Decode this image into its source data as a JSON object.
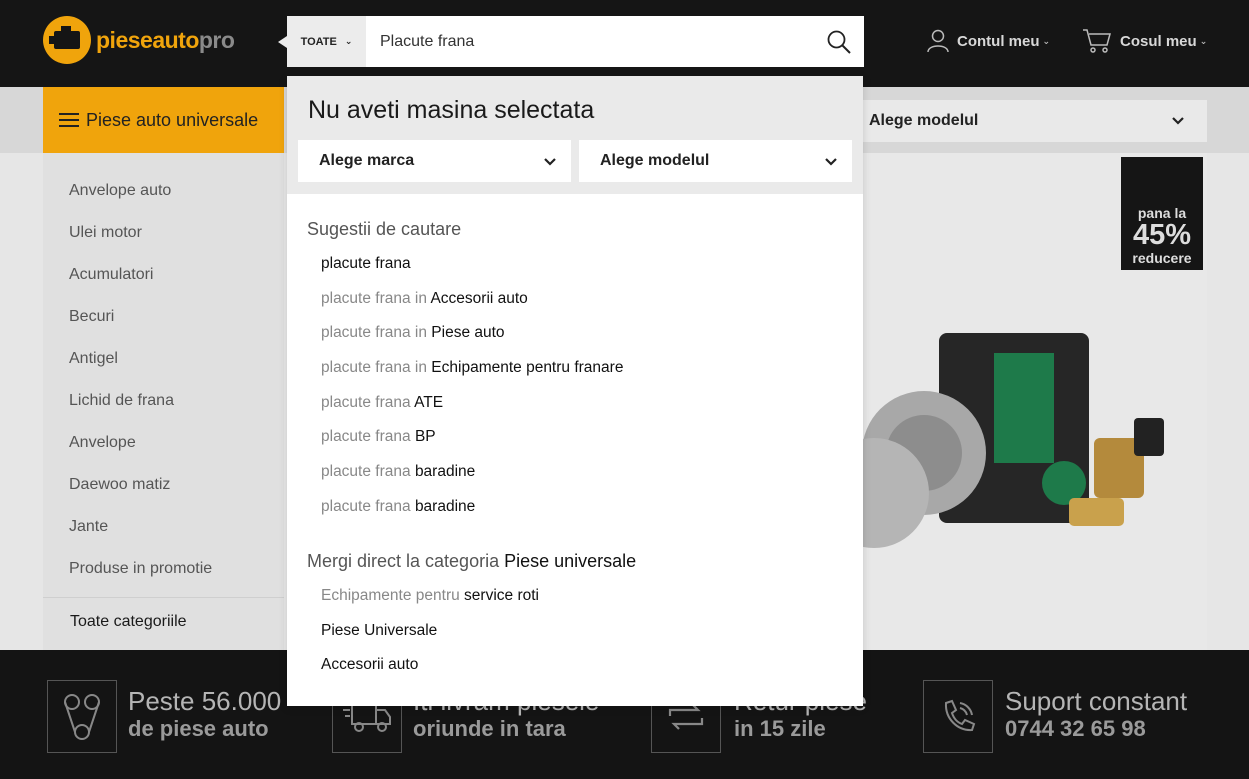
{
  "header": {
    "logo": {
      "part1": "pieseauto",
      "part2": "pro"
    },
    "account_label": "Contul meu",
    "cart_label": "Cosul meu",
    "icons": [
      "engine-logo-icon",
      "user-icon",
      "cart-icon",
      "search-icon"
    ]
  },
  "search": {
    "category": "TOATE",
    "value": "Placute frana"
  },
  "nav": {
    "universal_label": "Piese auto universale",
    "background_model_label": "Alege modelul"
  },
  "sidebar": {
    "items": [
      "Anvelope auto",
      "Ulei motor",
      "Acumulatori",
      "Becuri",
      "Antigel",
      "Lichid de frana",
      "Anvelope",
      "Daewoo matiz",
      "Jante",
      "Produse in promotie"
    ],
    "all_label": "Toate categoriile"
  },
  "promo": {
    "line1": "pana la",
    "line2": "45%",
    "line3": "reducere"
  },
  "features": [
    {
      "title": "Peste 56.000",
      "sub": "de piese auto",
      "icon": "timing-belt-icon"
    },
    {
      "title": "Iti livram piesele",
      "sub": "oriunde in tara",
      "icon": "delivery-truck-icon"
    },
    {
      "title": "Retur piese",
      "sub": "in 15 zile",
      "icon": "return-arrows-icon"
    },
    {
      "title": "Suport constant",
      "sub": "0744 32 65 98",
      "icon": "phone-icon"
    }
  ],
  "dropdown": {
    "heading": "Nu aveti masina selectata",
    "brand_select": "Alege marca",
    "model_select": "Alege modelul",
    "suggestions_title": "Sugestii de cautare",
    "suggestions": [
      {
        "prefix": "",
        "term": "placute frana"
      },
      {
        "prefix": "placute frana in ",
        "term": "Accesorii auto"
      },
      {
        "prefix": "placute frana in ",
        "term": "Piese auto"
      },
      {
        "prefix": "placute frana in ",
        "term": "Echipamente pentru franare"
      },
      {
        "prefix": "placute frana ",
        "term": "ATE"
      },
      {
        "prefix": "placute frana ",
        "term": "BP"
      },
      {
        "prefix": "placute frana ",
        "term": "baradine"
      },
      {
        "prefix": "placute frana ",
        "term": "baradine"
      }
    ],
    "category_title_prefix": "Mergi direct la categoria ",
    "category_title_strong": "Piese universale",
    "categories": [
      {
        "prefix": "Echipamente pentru ",
        "term": "service roti"
      },
      {
        "prefix": "",
        "term": "Piese Universale"
      },
      {
        "prefix": "",
        "term": "Accesorii auto"
      }
    ]
  },
  "colors": {
    "accent": "#f0a40c",
    "header_bg": "#151515",
    "strip_bg": "#141414"
  }
}
